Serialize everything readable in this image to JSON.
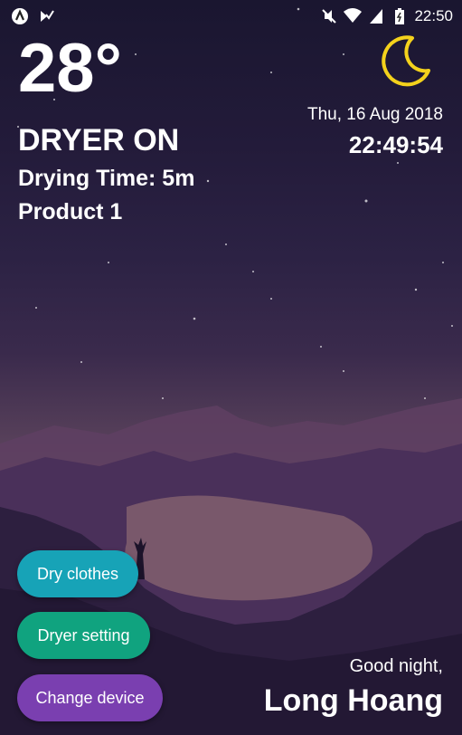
{
  "status_bar": {
    "time": "22:50",
    "left_icons": [
      "app-a-icon",
      "check-badge-icon"
    ],
    "right_icons": [
      "mute-icon",
      "wifi-icon",
      "signal-icon",
      "battery-icon"
    ]
  },
  "weather": {
    "temperature": "28°",
    "icon": "moon-icon",
    "icon_color": "#f4d21c"
  },
  "dryer": {
    "status": "DRYER ON",
    "drying_time": "Drying Time: 5m",
    "product": "Product 1"
  },
  "datetime": {
    "date": "Thu, 16 Aug 2018",
    "time": "22:49:54"
  },
  "buttons": {
    "dry_clothes": "Dry clothes",
    "dryer_setting": "Dryer setting",
    "change_device": "Change device"
  },
  "button_colors": {
    "dry_clothes": "#17a3b7",
    "dryer_setting": "#10a37f",
    "change_device": "#7a3fb0"
  },
  "greeting": {
    "text": "Good night,",
    "name": "Long Hoang"
  }
}
